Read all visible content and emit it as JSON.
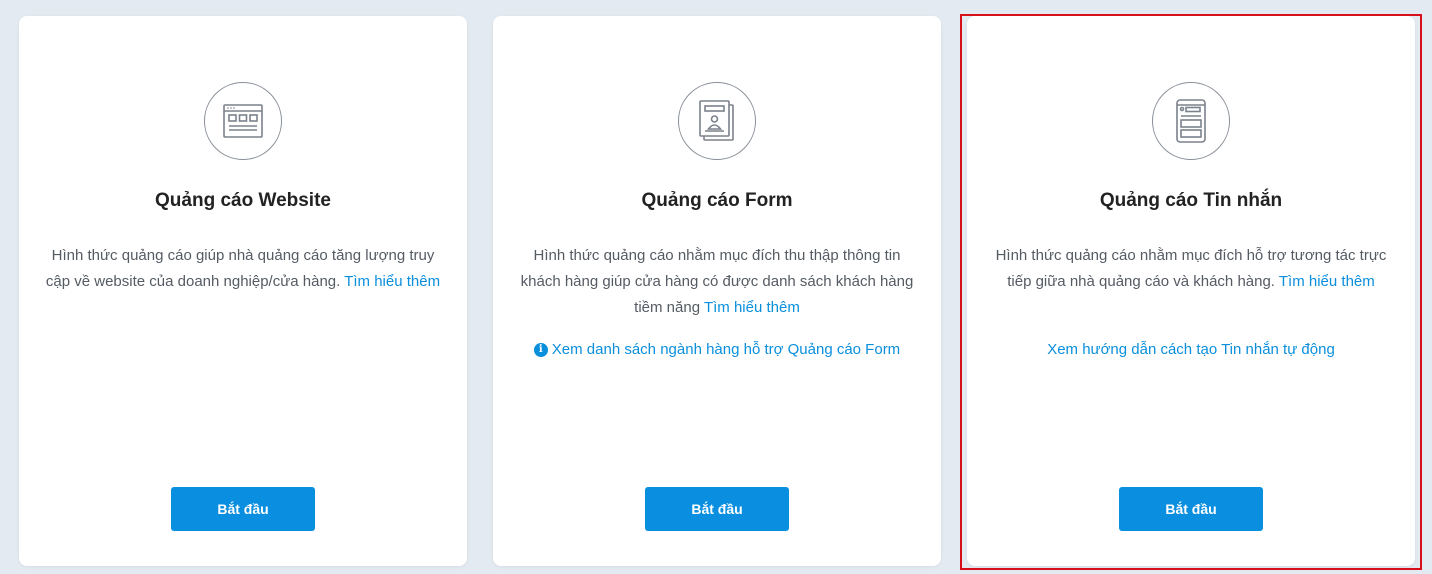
{
  "cards": [
    {
      "title": "Quảng cáo Website",
      "icon": "website-icon",
      "desc_text": "Hình thức quảng cáo giúp nhà quảng cáo tăng lượng truy cập về website của doanh nghiệp/cửa hàng.",
      "learn_more": "Tìm hiểu thêm",
      "button": "Bắt đầu"
    },
    {
      "title": "Quảng cáo Form",
      "icon": "form-icon",
      "desc_text": "Hình thức quảng cáo nhằm mục đích thu thập thông tin khách hàng giúp cửa hàng có được danh sách khách hàng tiềm năng",
      "learn_more": "Tìm hiểu thêm",
      "extra_link": "Xem danh sách ngành hàng hỗ trợ Quảng cáo Form",
      "button": "Bắt đầu"
    },
    {
      "title": "Quảng cáo Tin nhắn",
      "icon": "message-icon",
      "desc_text": "Hình thức quảng cáo nhằm mục đích hỗ trợ tương tác trực tiếp giữa nhà quảng cáo và khách hàng.",
      "learn_more": "Tìm hiểu thêm",
      "extra_link": "Xem hướng dẫn cách tạo Tin nhắn tự động",
      "button": "Bắt đầu"
    }
  ],
  "colors": {
    "background": "#e3eaf1",
    "link": "#0a8fdc",
    "button": "#0a8ee0",
    "highlight": "#d60f1b"
  }
}
